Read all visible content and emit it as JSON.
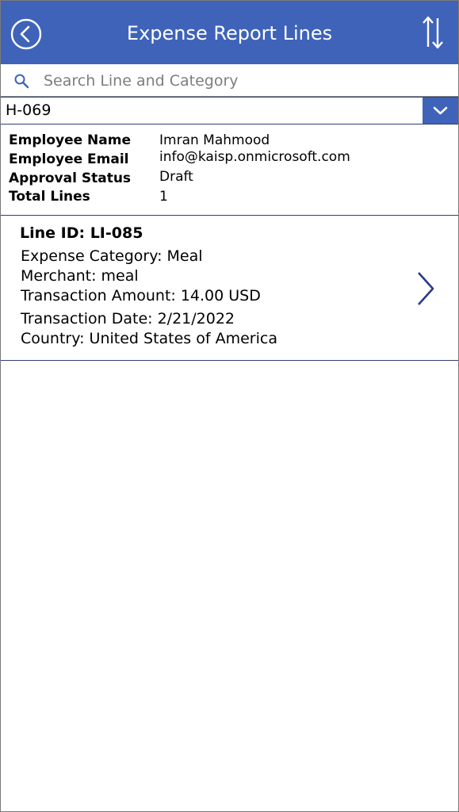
{
  "header": {
    "title": "Expense Report Lines",
    "back_icon": "circle-arrow-left-icon",
    "sort_icon": "sort-arrows-icon",
    "color": "#3e63b9"
  },
  "search": {
    "placeholder": "Search Line and Category",
    "value": ""
  },
  "dropdown": {
    "selected": "H-069"
  },
  "info": {
    "rows": [
      {
        "label": "Employee Name",
        "value": "Imran Mahmood"
      },
      {
        "label": "Employee Email",
        "value": "info@kaisp.onmicrosoft.com"
      },
      {
        "label": "Approval Status",
        "value": "Draft"
      },
      {
        "label": "Total Lines",
        "value": "1"
      }
    ]
  },
  "lines": [
    {
      "title": "Line ID: LI-085",
      "fields": [
        "Expense Category: Meal",
        "Merchant: meal",
        "Transaction Amount: 14.00 USD",
        "Transaction Date: 2/21/2022",
        "Country: United States of America"
      ]
    }
  ]
}
